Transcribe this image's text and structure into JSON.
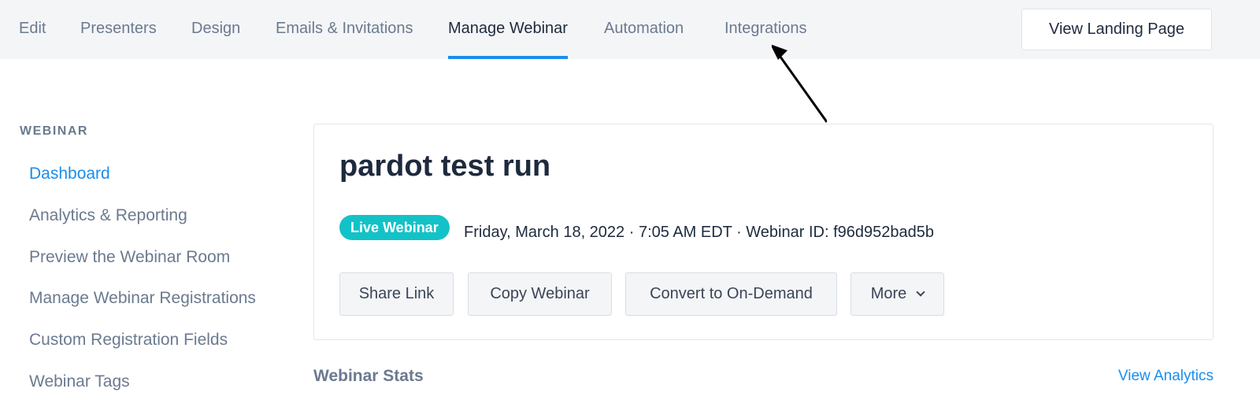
{
  "nav": {
    "tabs": [
      {
        "label": "Edit"
      },
      {
        "label": "Presenters"
      },
      {
        "label": "Design"
      },
      {
        "label": "Emails & Invitations"
      },
      {
        "label": "Manage Webinar",
        "active": true
      },
      {
        "label": "Automation"
      },
      {
        "label": "Integrations"
      }
    ],
    "landing_button": "View Landing Page"
  },
  "sidebar": {
    "heading": "WEBINAR",
    "items": [
      {
        "label": "Dashboard",
        "active": true
      },
      {
        "label": "Analytics & Reporting"
      },
      {
        "label": "Preview the Webinar Room"
      },
      {
        "label": "Manage Webinar Registrations"
      },
      {
        "label": "Custom Registration Fields"
      },
      {
        "label": "Webinar Tags"
      }
    ]
  },
  "webinar": {
    "title": "pardot test run",
    "badge": "Live Webinar",
    "meta": "Friday, March 18, 2022 · 7:05 AM EDT · Webinar ID: f96d952bad5b",
    "actions": {
      "share": "Share Link",
      "copy": "Copy Webinar",
      "convert": "Convert to On-Demand",
      "more": "More"
    }
  },
  "stats": {
    "title": "Webinar Stats",
    "link": "View Analytics"
  },
  "colors": {
    "accent": "#1a8ded",
    "badge": "#13c2c7",
    "nav_bg": "#f4f5f7"
  }
}
